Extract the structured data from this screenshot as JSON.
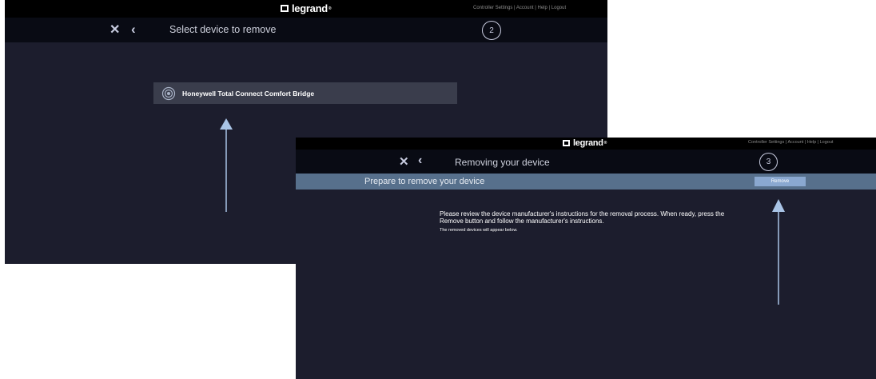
{
  "brand": {
    "logo_text": "legrand",
    "trademark": "®"
  },
  "utility_links": [
    "Controller Settings",
    "Account",
    "Help",
    "Logout"
  ],
  "screen1": {
    "title": "Select device to remove",
    "step": "2",
    "device_label": "Honeywell Total Connect Comfort Bridge"
  },
  "screen2": {
    "title": "Removing your device",
    "step": "3",
    "prepare_text": "Prepare to remove your device",
    "remove_label": "Remove",
    "instructions": "Please review the device manufacturer's instructions for the removal process. When ready, press the Remove button and follow the manufacturer's instructions.",
    "removed_note": "The removed devices will appear below."
  },
  "colors": {
    "top_strip": "#000000",
    "title_bar": "#090b14",
    "content_bg": "#1c1d2d",
    "device_card": "#3a3d4c",
    "prepare_bar": "#57708c",
    "remove_button": "#8aa8d0",
    "arrow": "#a9c4e6"
  },
  "icons": [
    "close-icon",
    "back-icon",
    "thermostat-icon",
    "up-arrow-icon"
  ]
}
